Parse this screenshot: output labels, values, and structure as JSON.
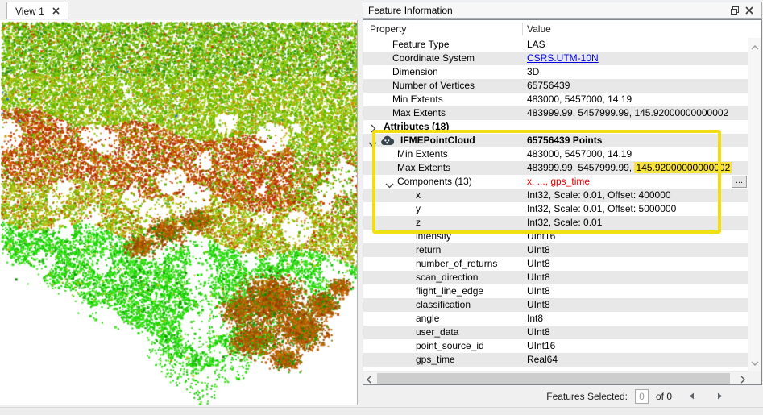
{
  "colors": {
    "annotation_yellow": "#f0df12",
    "value_highlight_bg": "#f8e33c",
    "link_blue": "#0000dd",
    "warning_red": "#e60000",
    "alt_row_gray": "#e8e8e8"
  },
  "icons": {
    "tab_close": "close-icon",
    "panel_float": "float-window-icon",
    "panel_close": "close-icon",
    "pointcloud_row": "point-cloud-icon",
    "tree_expanded": "chevron-down-icon",
    "tree_collapsed": "chevron-right-icon"
  },
  "view": {
    "tab_label": "View 1"
  },
  "panel": {
    "title": "Feature Information",
    "columns": {
      "property": "Property",
      "value": "Value"
    },
    "more_button_label": "...",
    "rows": [
      {
        "property": "Feature Type",
        "value": "LAS",
        "indent": "l1",
        "alt": false
      },
      {
        "property": "Coordinate System",
        "value": "CSRS.UTM-10N",
        "indent": "l1",
        "alt": true,
        "link": true
      },
      {
        "property": "Dimension",
        "value": "3D",
        "indent": "l1",
        "alt": false
      },
      {
        "property": "Number of Vertices",
        "value": "65756439",
        "indent": "l1",
        "alt": true
      },
      {
        "property": "Min Extents",
        "value": "483000, 5457000, 14.19",
        "indent": "l1",
        "alt": false
      },
      {
        "property": "Max Extents",
        "value": "483999.99, 5457999.99, 145.92000000000002",
        "indent": "l1",
        "alt": true
      },
      {
        "property": "Attributes (18)",
        "value": "",
        "indent": "grp",
        "alt": false,
        "bold": true,
        "arrow": "collapsed"
      },
      {
        "property": "IFMEPointCloud",
        "value": "65756439 Points",
        "indent": "pc",
        "alt": true,
        "bold": true,
        "arrow": "expanded",
        "icon": true
      },
      {
        "property": "Min Extents",
        "value": "483000, 5457000, 14.19",
        "indent": "l2",
        "alt": false
      },
      {
        "property": "Max Extents",
        "value_prefix": "483999.99, 5457999.99, ",
        "value_highlight": "145.92000000000002",
        "indent": "l2",
        "alt": true
      },
      {
        "property": "Components (13)",
        "value": "x, ..., gps_time",
        "indent": "l2",
        "alt": false,
        "arrow": "expanded",
        "red": true,
        "more_button": true
      },
      {
        "property": "x",
        "value": "Int32, Scale: 0.01, Offset: 400000",
        "indent": "l3",
        "alt": true
      },
      {
        "property": "y",
        "value": "Int32, Scale: 0.01, Offset: 5000000",
        "indent": "l3",
        "alt": false
      },
      {
        "property": "z",
        "value": "Int32, Scale: 0.01",
        "indent": "l3",
        "alt": true
      },
      {
        "property": "intensity",
        "value": "UInt16",
        "indent": "l3",
        "alt": false
      },
      {
        "property": "return",
        "value": "UInt8",
        "indent": "l3",
        "alt": true
      },
      {
        "property": "number_of_returns",
        "value": "UInt8",
        "indent": "l3",
        "alt": false
      },
      {
        "property": "scan_direction",
        "value": "UInt8",
        "indent": "l3",
        "alt": true
      },
      {
        "property": "flight_line_edge",
        "value": "UInt8",
        "indent": "l3",
        "alt": false
      },
      {
        "property": "classification",
        "value": "UInt8",
        "indent": "l3",
        "alt": true
      },
      {
        "property": "angle",
        "value": "Int8",
        "indent": "l3",
        "alt": false
      },
      {
        "property": "user_data",
        "value": "UInt8",
        "indent": "l3",
        "alt": true
      },
      {
        "property": "point_source_id",
        "value": "UInt16",
        "indent": "l3",
        "alt": false
      },
      {
        "property": "gps_time",
        "value": "Real64",
        "indent": "l3",
        "alt": true
      }
    ]
  },
  "status": {
    "features_selected_label": "Features Selected:",
    "count_value": "0",
    "of_label": "of 0"
  }
}
